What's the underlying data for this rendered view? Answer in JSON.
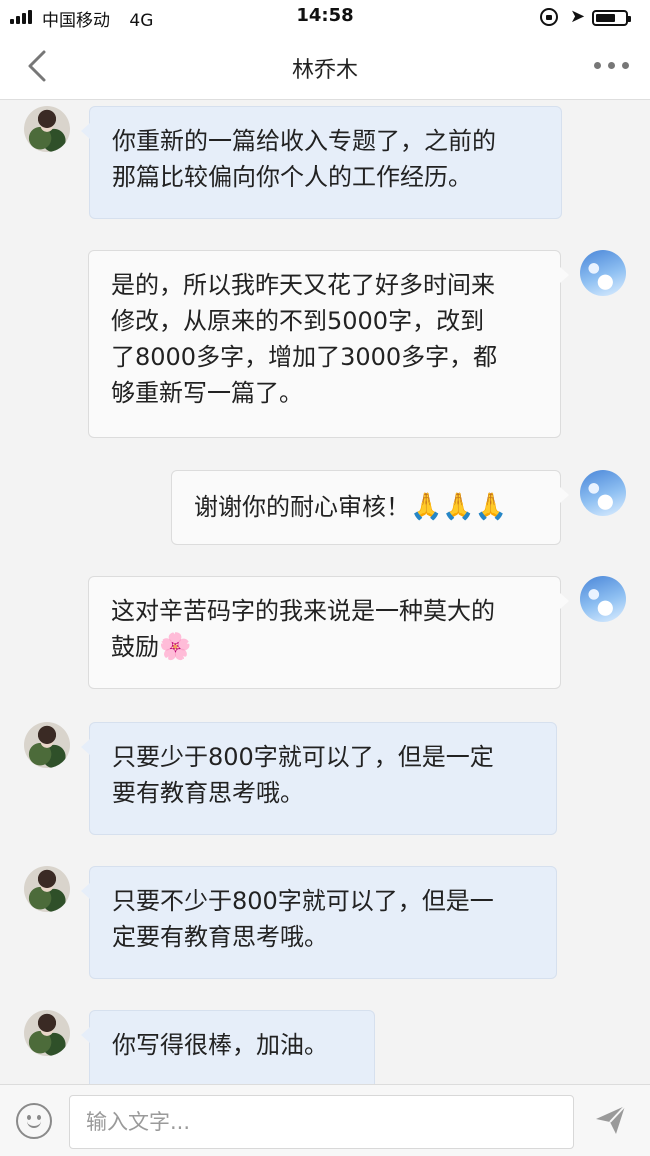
{
  "status_bar": {
    "carrier": "中国移动",
    "network": "4G",
    "time": "14:58",
    "battery_level": 0.6
  },
  "nav": {
    "title": "林乔木",
    "back_icon": "chevron-left-icon",
    "more_icon": "more-dots-icon"
  },
  "messages": [
    {
      "side": "received",
      "lines": [
        "你重新的一篇给收入专题了，之前的",
        "那篇比较偏向你个人的工作经历。"
      ]
    },
    {
      "side": "sent",
      "lines": [
        "是的，所以我昨天又花了好多时间来",
        "修改，从原来的不到5000字，改到",
        "了8000多字，增加了3000多字，都",
        "够重新写一篇了。"
      ]
    },
    {
      "side": "sent",
      "text": "谢谢你的耐心审核！",
      "emoji": "🙏🙏🙏"
    },
    {
      "side": "sent",
      "lines": [
        "这对辛苦码字的我来说是一种莫大的",
        "鼓励"
      ],
      "emoji": "🌸"
    },
    {
      "side": "received",
      "lines": [
        "只要少于800字就可以了，但是一定",
        "要有教育思考哦。"
      ]
    },
    {
      "side": "received",
      "lines": [
        "只要不少于800字就可以了，但是一",
        "定要有教育思考哦。"
      ]
    },
    {
      "side": "received",
      "text": "你写得很棒，加油。"
    }
  ],
  "input": {
    "placeholder": "输入文字...",
    "value": ""
  },
  "colors": {
    "received_bubble": "#e6eef9",
    "sent_bubble": "#fafafa",
    "background": "#f3f3f3"
  }
}
